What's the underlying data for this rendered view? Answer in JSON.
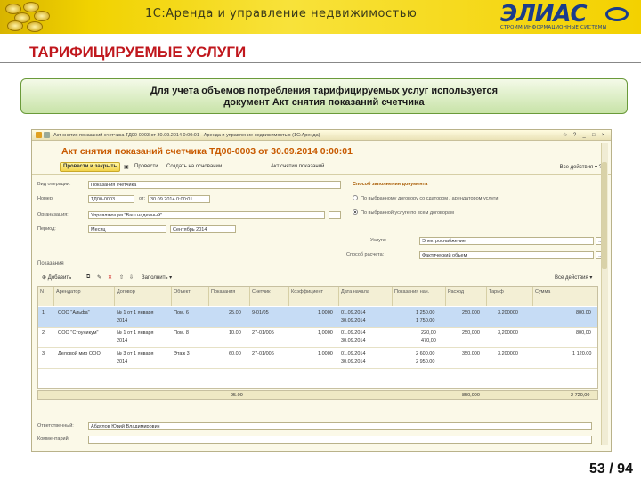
{
  "banner": {
    "title": "1С:Аренда и управление недвижимостью",
    "logo_text": "ЭЛИАС",
    "logo_subtitle": "СТРОИМ ИНФОРМАЦИОННЫЕ СИСТЕМЫ"
  },
  "section_title": "ТАРИФИЦИРУЕМЫЕ УСЛУГИ",
  "caption": {
    "line1": "Для учета объемов потребления тарифицируемых услуг используется",
    "line2": "документ Акт снятия показаний счетчика"
  },
  "window": {
    "title": "Акт снятия показаний счетчика ТД00-0003 от 30.09.2014 0:00:01 - Аренда и управление недвижимостью (1С:Аренда)",
    "doc_title": "Акт снятия показаний счетчика ТД00-0003 от 30.09.2014 0:00:01",
    "toolbar": {
      "post_close": "Провести и закрыть",
      "post": "Провести",
      "create_based": "Создать на основании",
      "print": "Акт снятия показаний",
      "actions": "Все действия"
    },
    "form": {
      "operation_label": "Вид операции:",
      "operation_value": "Показания счетчика",
      "number_label": "Номер:",
      "number_value": "ТД00-0003",
      "date_label": "от:",
      "date_value": "30.09.2014 0:00:01",
      "org_label": "Организация:",
      "org_value": "Управляющая \"Ваш надежный\"",
      "period_label": "Период:",
      "period_type": "Месяц",
      "period_value": "Сентябрь 2014",
      "fill_header": "Способ заполнения документа",
      "radio1": "По выбранному договору со сдатором / арендатором услуги",
      "radio2": "По выбранной услуге по всем договорам",
      "service_label": "Услуга:",
      "service_value": "Электроснабжение",
      "method_label": "Способ расчета:",
      "method_value": "Фактический объем"
    },
    "tab_label": "Показания",
    "table_toolbar": {
      "add": "Добавить",
      "fill": "Заполнить",
      "actions": "Все действия"
    },
    "columns": [
      "N",
      "Арендатор",
      "Договор",
      "Объект",
      "Показания",
      "Счетчик",
      "Коэффициент",
      "Дата начала",
      "Показания нач.",
      "Расход",
      "Тариф",
      "Сумма"
    ],
    "rows": [
      {
        "n": "1",
        "tenant": "ООО \"Альфа\"",
        "contract": "№ 1 от 1 января",
        "contract2": "2014",
        "object": "Пом. 6",
        "reading": "25.00",
        "meter": "9-01/05",
        "coef": "1,0000",
        "date1": "01.09.2014",
        "date2": "30.09.2014",
        "val1": "1 250,00",
        "val2": "1 750,00",
        "usage": "250,000",
        "tariff": "3,200000",
        "sum": "800,00"
      },
      {
        "n": "2",
        "tenant": "ООО \"Стоуникум\"",
        "contract": "№ 1 от 1 января",
        "contract2": "2014",
        "object": "Пом. 8",
        "reading": "10.00",
        "meter": "27-01/005",
        "coef": "1,0000",
        "date1": "01.09.2014",
        "date2": "30.09.2014",
        "val1": "220,00",
        "val2": "470,00",
        "usage": "250,000",
        "tariff": "3,200000",
        "sum": "800,00"
      },
      {
        "n": "3",
        "tenant": "Деловой мир ООО",
        "contract": "№ 3 от 1 января",
        "contract2": "2014",
        "object": "Этаж 3",
        "reading": "60.00",
        "meter": "27-01/006",
        "coef": "1,0000",
        "date1": "01.09.2014",
        "date2": "30.09.2014",
        "val1": "2 600,00",
        "val2": "2 950,00",
        "usage": "350,000",
        "tariff": "3,200000",
        "sum": "1 120,00"
      }
    ],
    "totals": {
      "reading": "95.00",
      "usage": "850,000",
      "sum": "2 720,00"
    },
    "footer": {
      "responsible_label": "Ответственный:",
      "responsible_value": "Абдулов Юрий Владимирович",
      "comment_label": "Комментарий:"
    }
  },
  "page_number": "53 / 94"
}
